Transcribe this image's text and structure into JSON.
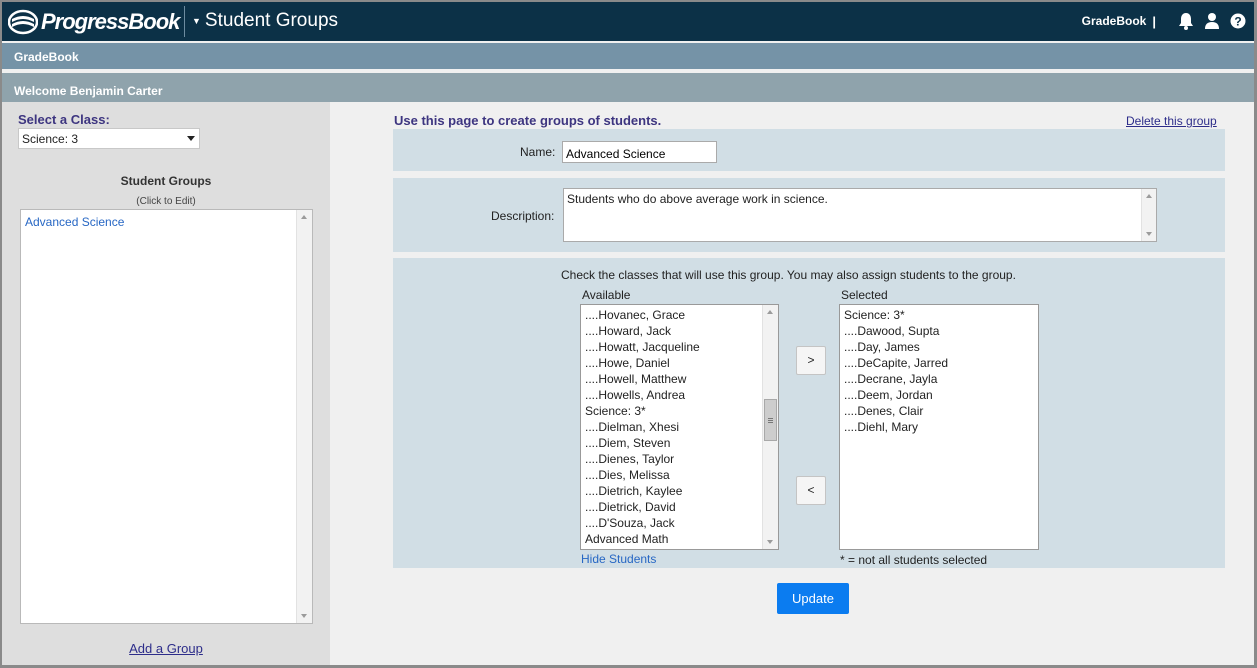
{
  "header": {
    "brand": "ProgressBook",
    "app_title": "Student Groups",
    "app_label": "GradeBook",
    "separator": "|",
    "icons": [
      "bell-icon",
      "user-icon",
      "help-icon"
    ]
  },
  "subbar": {
    "label": "GradeBook"
  },
  "welcome": {
    "text": "Welcome Benjamin Carter"
  },
  "left": {
    "select_label": "Select a Class:",
    "selected_class": "Science: 3",
    "groups_title": "Student Groups",
    "groups_subtitle": "(Click to Edit)",
    "groups": [
      "Advanced Science"
    ],
    "add_group": "Add a Group"
  },
  "main": {
    "intro": "Use this page to create groups of students.",
    "delete_link": "Delete this group",
    "name_label": "Name:",
    "name_value": "Advanced Science",
    "description_label": "Description:",
    "description_value": "Students who do above average work in science.",
    "instruction": "Check the classes that will use this group.  You may also assign students to the group.",
    "available_label": "Available",
    "selected_label": "Selected",
    "available": [
      "....Hovanec, Grace",
      "....Howard, Jack",
      "....Howatt, Jacqueline",
      "....Howe, Daniel",
      "....Howell, Matthew",
      "....Howells, Andrea",
      "Science: 3*",
      "....Dielman, Xhesi",
      "....Diem, Steven",
      "....Dienes, Taylor",
      "....Dies, Melissa",
      "....Dietrich, Kaylee",
      "....Dietrick, David",
      "....D'Souza, Jack",
      "Advanced Math"
    ],
    "selected": [
      "Science: 3*",
      "....Dawood, Supta",
      "....Day, James",
      "....DeCapite, Jarred",
      "....Decrane, Jayla",
      "....Deem, Jordan",
      "....Denes, Clair",
      "....Diehl, Mary"
    ],
    "add_button": ">",
    "remove_button": "<",
    "hide_students": "Hide Students",
    "legend": "* = not all students selected",
    "update_button": "Update"
  },
  "colors": {
    "topbar": "#0c3147",
    "subbar": "#7593a7",
    "welcome": "#8fa3ac",
    "band": "#d1dee5",
    "heading": "#3d3580",
    "link": "#2767c4",
    "update": "#0b7cf0"
  }
}
